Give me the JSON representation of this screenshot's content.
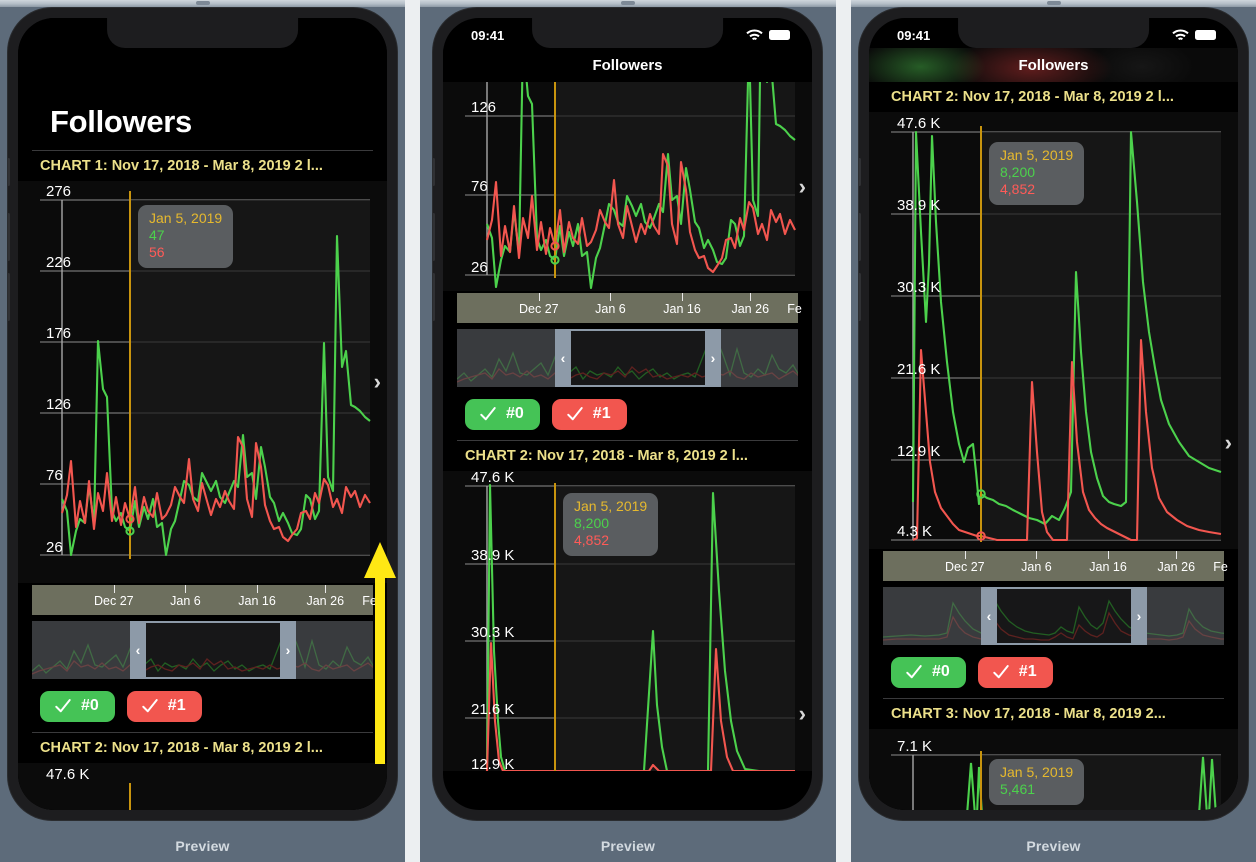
{
  "previews": {
    "label": "Preview"
  },
  "status": {
    "time": "09:41",
    "wifi_icon": "wifi-icon",
    "battery_icon": "battery-icon"
  },
  "nav": {
    "title": "Followers"
  },
  "large_title": "Followers",
  "chart_titles": {
    "chart1": "CHART 1:  Nov 17, 2018 - Mar 8, 2019  2  l...",
    "chart2": "CHART 2:  Nov 17, 2018 - Mar 8, 2019  2  l...",
    "chart2_short": "CHART 2:  Nov 17, 2018 - Mar 8, 2019  2  l...",
    "chart3": "CHART 3:  Nov 17, 2018 - Mar 8, 2019  2..."
  },
  "tooltips": {
    "chart1": {
      "date": "Jan 5, 2019",
      "green": "47",
      "red": "56"
    },
    "chart2": {
      "date": "Jan 5, 2019",
      "green": "8,200",
      "red": "4,852"
    },
    "chart3": {
      "date": "Jan 5, 2019",
      "green": "5,461",
      "red": ""
    }
  },
  "buttons": {
    "series0": {
      "label": "#0",
      "color": "#45c356",
      "icon": "checkmark-icon"
    },
    "series1": {
      "label": "#1",
      "color": "#f2564f",
      "icon": "checkmark-icon"
    }
  },
  "nav_chevron": "chevron-right-icon",
  "scrubber": {
    "left_handle": "‹",
    "right_handle": "›"
  },
  "colors": {
    "green_series": "#4cd14c",
    "red_series": "#f2564f",
    "cursor_line": "#c8940e",
    "title_yellow": "#ece08a",
    "panel_bg": "#5d6b7a",
    "annotation_arrow": "#ffe814"
  },
  "chart_data": [
    {
      "id": "chart1",
      "type": "line",
      "title": "CHART 1:  Nov 17, 2018 - Mar 8, 2019  2  l...",
      "ylabel": "",
      "xlabel": "",
      "ytick_labels": [
        "276",
        "226",
        "176",
        "126",
        "76",
        "26"
      ],
      "ytick_values": [
        276,
        226,
        176,
        126,
        76,
        26
      ],
      "ylim": [
        26,
        276
      ],
      "xtick_labels": [
        "Dec 27",
        "Jan 6",
        "Jan 16",
        "Jan 26",
        "Fe"
      ],
      "grid": true,
      "legend": [
        "#0",
        "#1"
      ],
      "cursor_date": "Jan 5, 2019",
      "cursor_values": {
        "#0": 47,
        "#1": 56
      },
      "series": [
        {
          "name": "#0",
          "color": "#4cd14c",
          "values": [
            72,
            58,
            30,
            26,
            44,
            36,
            74,
            38,
            176,
            125,
            118,
            62,
            48,
            56,
            38,
            34,
            62,
            36,
            54,
            42,
            58,
            30,
            34,
            26,
            47,
            38,
            72,
            84,
            80,
            66,
            62,
            94,
            80,
            70,
            78,
            62,
            58,
            66,
            78,
            72,
            120,
            82,
            86,
            58,
            110,
            94,
            62,
            56,
            42,
            50,
            40,
            32,
            30,
            34,
            60,
            58,
            40,
            46,
            170,
            84,
            66,
            270,
            164,
            176,
            118,
            116,
            112,
            105,
            100
          ]
        },
        {
          "name": "#1",
          "color": "#f2564f",
          "values": [
            60,
            76,
            100,
            38,
            62,
            40,
            84,
            36,
            74,
            56,
            92,
            42,
            66,
            38,
            58,
            44,
            72,
            40,
            66,
            56,
            50,
            70,
            44,
            48,
            56,
            72,
            66,
            60,
            102,
            62,
            52,
            74,
            58,
            46,
            62,
            54,
            68,
            58,
            52,
            116,
            108,
            62,
            48,
            112,
            96,
            56,
            40,
            34,
            36,
            30,
            28,
            33,
            38,
            50,
            52,
            46,
            70,
            62,
            88,
            84,
            68,
            72,
            58,
            86,
            78,
            82,
            66,
            90,
            78
          ]
        }
      ]
    },
    {
      "id": "chart2",
      "type": "line",
      "title": "CHART 2:  Nov 17, 2018 - Mar 8, 2019  2  l...",
      "ytick_labels": [
        "47.6 K",
        "38.9 K",
        "30.3 K",
        "21.6 K",
        "12.9 K",
        "4.3 K"
      ],
      "ytick_values": [
        47600,
        38900,
        30300,
        21600,
        12900,
        4300
      ],
      "ylim": [
        4300,
        47600
      ],
      "xtick_labels": [
        "Dec 27",
        "Jan 6",
        "Jan 16",
        "Jan 26",
        "Fe"
      ],
      "grid": true,
      "legend": [
        "#0",
        "#1"
      ],
      "cursor_date": "Jan 5, 2019",
      "cursor_values": {
        "#0": 8200,
        "#1": 4852
      },
      "series": [
        {
          "name": "#0",
          "color": "#4cd14c",
          "values": [
            6000,
            47600,
            30000,
            20000,
            15000,
            13000,
            12800,
            11000,
            9500,
            8600,
            8200,
            8100,
            7900,
            7800,
            7700,
            7600,
            7500,
            7400,
            31000,
            20000,
            13000,
            9000,
            8200,
            8100,
            47600,
            31000,
            24000,
            19000,
            15500,
            13500,
            12500,
            11500,
            11000
          ]
        },
        {
          "name": "#1",
          "color": "#f2564f",
          "values": [
            4300,
            21600,
            12000,
            8000,
            6000,
            5200,
            4900,
            4700,
            4600,
            4852,
            4500,
            4400,
            4400,
            4400,
            4400,
            14000,
            6000,
            5000,
            22000,
            9000,
            6000,
            5200,
            4800,
            4500,
            22600,
            12000,
            8000,
            6500,
            6000,
            5800,
            5600,
            5500,
            5400
          ]
        }
      ]
    },
    {
      "id": "chart3",
      "type": "line",
      "title": "CHART 3:  Nov 17, 2018 - Mar 8, 2019  2...",
      "ytick_labels": [
        "7.1 K"
      ],
      "ytick_values": [
        7100
      ],
      "ylim": [
        0,
        7100
      ],
      "cursor_date": "Jan 5, 2019",
      "cursor_values": {
        "#0": 5461
      },
      "series": [
        {
          "name": "#0",
          "color": "#4cd14c",
          "values": [
            0,
            5200,
            5400,
            0,
            0,
            0,
            0,
            6900,
            0
          ]
        }
      ]
    }
  ]
}
